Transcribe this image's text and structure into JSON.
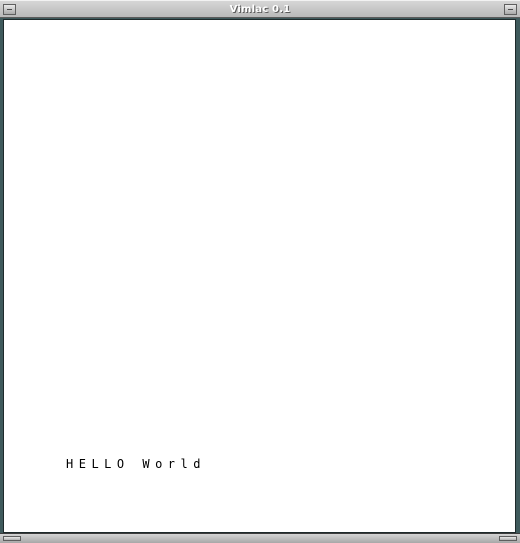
{
  "window": {
    "title": "Vimlac 0.1"
  },
  "display": {
    "text": "HELLO World"
  }
}
